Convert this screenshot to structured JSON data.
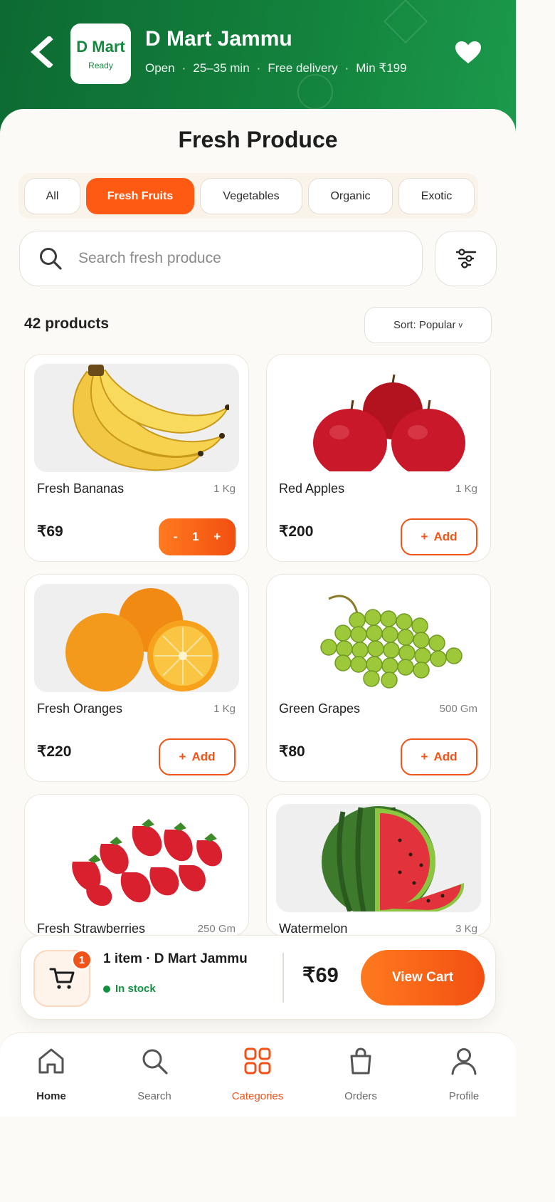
{
  "header": {
    "store_name": "D Mart Jammu",
    "logo_text": "D Mart",
    "logo_subtext": "Ready",
    "meta": [
      "Open",
      "·",
      "25–35 min",
      "·",
      "Free delivery",
      "·",
      "Min ₹199"
    ],
    "brand_color": "#138a3e"
  },
  "page_title": "Fresh Produce",
  "chips": [
    {
      "label": "All",
      "active": false
    },
    {
      "label": "Fresh Fruits",
      "active": true
    },
    {
      "label": "Vegetables",
      "active": false
    },
    {
      "label": "Organic",
      "active": false
    },
    {
      "label": "Exotic",
      "active": false
    }
  ],
  "search": {
    "placeholder": "Search fresh produce"
  },
  "results": {
    "count_label": "42 products",
    "sort_label": "Sort: Popular",
    "sort_chevron": "v"
  },
  "products": [
    {
      "name": "Fresh Bananas",
      "unit": "1 Kg",
      "price": "₹69",
      "in_cart": true,
      "qty": "1",
      "icon": "banana"
    },
    {
      "name": "Red Apples",
      "unit": "1 Kg",
      "price": "₹200",
      "in_cart": false,
      "add_label": "Add",
      "icon": "apple"
    },
    {
      "name": "Fresh Oranges",
      "unit": "1 Kg",
      "price": "₹220",
      "in_cart": false,
      "add_label": "Add",
      "icon": "orange"
    },
    {
      "name": "Green Grapes",
      "unit": "500 Gm",
      "price": "₹80",
      "in_cart": false,
      "add_label": "Add",
      "icon": "grapes"
    },
    {
      "name": "Fresh Strawberries",
      "unit": "250 Gm",
      "price": "",
      "icon": "strawberry"
    },
    {
      "name": "Watermelon",
      "unit": "3 Kg",
      "price": "",
      "icon": "watermelon"
    }
  ],
  "qty_controls": {
    "minus": "-",
    "plus": "+"
  },
  "add_prefix": "+",
  "cart": {
    "badge": "1",
    "title": "1 item · D Mart Jammu",
    "stock": "In stock",
    "total": "₹69",
    "cta": "View Cart"
  },
  "nav": [
    {
      "label": "Home",
      "icon": "home-icon",
      "active": false
    },
    {
      "label": "Search",
      "icon": "search-icon",
      "active": false
    },
    {
      "label": "Categories",
      "icon": "grid-icon",
      "active": true
    },
    {
      "label": "Orders",
      "icon": "bag-icon",
      "active": false
    },
    {
      "label": "Profile",
      "icon": "user-icon",
      "active": false
    }
  ],
  "colors": {
    "accent": "#f0531a",
    "green": "#13833d"
  }
}
